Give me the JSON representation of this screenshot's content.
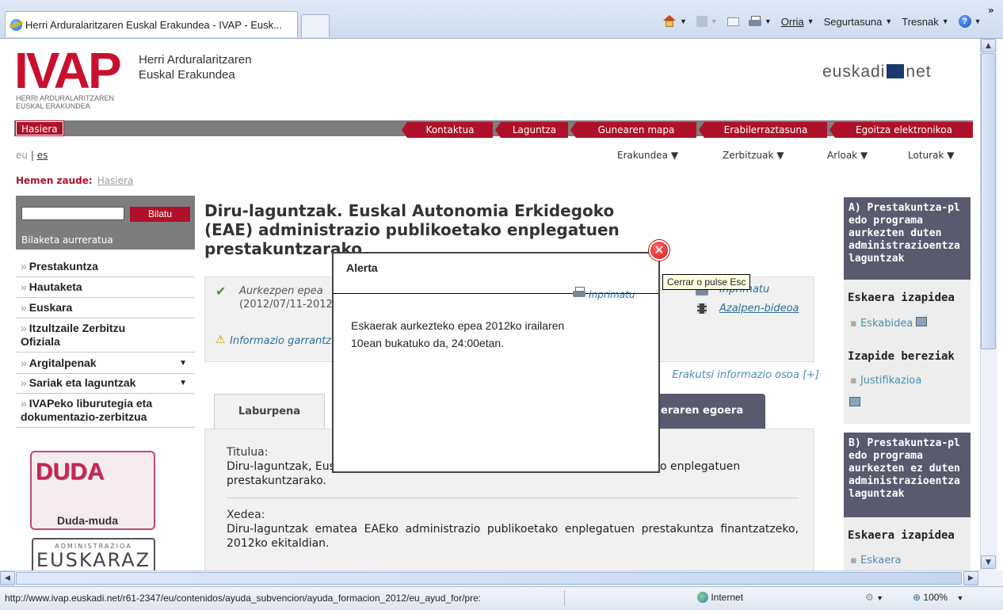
{
  "browser": {
    "tab_title": "Herri Arduralaritzaren Euskal Erakundea - IVAP - Eusk...",
    "commands": {
      "page": "Orria",
      "security": "Segurtasuna",
      "tools": "Tresnak",
      "more": "»"
    },
    "status_url": "http://www.ivap.euskadi.net/r61-2347/eu/contenidos/ayuda_subvencion/ayuda_formacion_2012/eu_ayud_for/pre:",
    "zone": "Internet",
    "zoom": "100%"
  },
  "header": {
    "logo": "IVAP",
    "logo_sub1": "HERRI ARDURALARITZAREN",
    "logo_sub2": "EUSKAL ERAKUNDEA",
    "name_line1": "Herri Arduralaritzaren",
    "name_line2": "Euskal Erakundea",
    "partner_left": "euskadi",
    "partner_right": "net"
  },
  "topnav": {
    "home": "Hasiera",
    "items": [
      "Kontaktua",
      "Laguntza",
      "Gunearen mapa",
      "Erabilerraztasuna",
      "Egoitza elektronikoa"
    ]
  },
  "lang": {
    "eu": "eu",
    "sep": "|",
    "es": "es"
  },
  "subnav": [
    "Erakundea",
    "Zerbitzuak",
    "Arloak",
    "Loturak"
  ],
  "breadcrumb": {
    "label": "Hemen zaude:",
    "home": "Hasiera"
  },
  "sidebar": {
    "search_button": "Bilatu",
    "advanced": "Bilaketa aurreratua",
    "items": [
      "Prestakuntza",
      "Hautaketa",
      "Euskara",
      "Itzultzaile Zerbitzu Ofiziala",
      "Argitalpenak",
      "Sariak eta laguntzak",
      "IVAPeko liburutegia eta dokumentazio-zerbitzua"
    ],
    "chevron": "»",
    "banner1": "Duda-muda",
    "banner2_small": "ADMINISTRAZIOA",
    "banner2_big": "EUSKARAZ"
  },
  "main": {
    "title_line1": "Diru-laguntzak. Euskal Autonomia Erkidegoko",
    "title_line2": "(EAE) administrazio publikoetako enplegatuen",
    "title_line3": "prestakuntzarako",
    "period_label": "Aurkezpen epea",
    "period_dates": "(2012/07/11-2012/09/10)",
    "info_important": "Informazio garrantzitsua",
    "print": "Inprimatu",
    "video": "Azalpen-bideoa",
    "show_full": "Erakutsi informazio osoa [+]",
    "tab_summary": "Laburpena",
    "tab_status": "Eskaeraren egoera",
    "title_label": "Titulua:",
    "title_value": "Diru-laguntzak, Euskal Autonomia Erkidegoko (EAE) administrazio publikoetako enplegatuen prestakuntzarako.",
    "purpose_label": "Xedea:",
    "purpose_value": "Diru-laguntzak ematea EAEko administrazio publikoetako enplegatuen prestakuntza finantzatzeko, 2012ko ekitaldian."
  },
  "right": {
    "box_a_title": [
      "A) Prestakuntza-pl",
      "edo programa",
      "aurkezten duten",
      "administrazioentza",
      "laguntzak"
    ],
    "request_procedure": "Eskaera izapidea",
    "request_link_a": "Eskabidea",
    "special_procedures": "Izapide bereziak",
    "justification": "Justifikazioa",
    "box_b_title": [
      "B) Prestakuntza-pl",
      "edo programa",
      "aurkezten ez duten",
      "administrazioentza",
      "laguntzak"
    ],
    "request_link_b": "Eskaera"
  },
  "modal": {
    "title": "Alerta",
    "print": "Inprimatu",
    "body": "Eskaerak aurkezteko epea 2012ko irailaren 10ean bukatuko da, 24:00etan.",
    "close_tooltip": "Cerrar o pulse Esc",
    "close_glyph": "✕"
  },
  "colors": {
    "brand_red": "#b0112a",
    "sidebar_grey": "#7d7d7d",
    "right_head": "#5a5a6e",
    "link_blue": "#4a8fb0"
  }
}
